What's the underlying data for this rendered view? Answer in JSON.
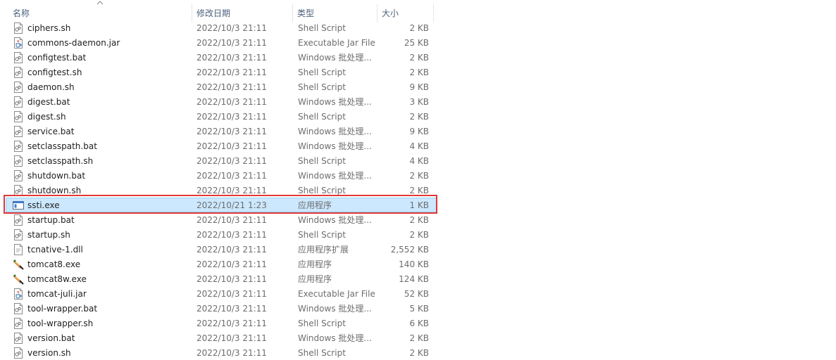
{
  "header": {
    "name": "名称",
    "date": "修改日期",
    "type": "类型",
    "size": "大小"
  },
  "colors": {
    "selected_bg": "#cce8ff",
    "selected_border": "#99d1ff",
    "highlight_box": "#e0383b",
    "header_text": "#4c607a"
  },
  "files": [
    {
      "name": "ciphers.sh",
      "date": "2022/10/3 21:11",
      "type": "Shell Script",
      "size": "2 KB",
      "icon": "script-file-icon"
    },
    {
      "name": "commons-daemon.jar",
      "date": "2022/10/3 21:11",
      "type": "Executable Jar File",
      "size": "25 KB",
      "icon": "jar-file-icon"
    },
    {
      "name": "configtest.bat",
      "date": "2022/10/3 21:11",
      "type": "Windows 批处理...",
      "size": "2 KB",
      "icon": "script-file-icon"
    },
    {
      "name": "configtest.sh",
      "date": "2022/10/3 21:11",
      "type": "Shell Script",
      "size": "2 KB",
      "icon": "script-file-icon"
    },
    {
      "name": "daemon.sh",
      "date": "2022/10/3 21:11",
      "type": "Shell Script",
      "size": "9 KB",
      "icon": "script-file-icon"
    },
    {
      "name": "digest.bat",
      "date": "2022/10/3 21:11",
      "type": "Windows 批处理...",
      "size": "3 KB",
      "icon": "script-file-icon"
    },
    {
      "name": "digest.sh",
      "date": "2022/10/3 21:11",
      "type": "Shell Script",
      "size": "2 KB",
      "icon": "script-file-icon"
    },
    {
      "name": "service.bat",
      "date": "2022/10/3 21:11",
      "type": "Windows 批处理...",
      "size": "9 KB",
      "icon": "script-file-icon"
    },
    {
      "name": "setclasspath.bat",
      "date": "2022/10/3 21:11",
      "type": "Windows 批处理...",
      "size": "4 KB",
      "icon": "script-file-icon"
    },
    {
      "name": "setclasspath.sh",
      "date": "2022/10/3 21:11",
      "type": "Shell Script",
      "size": "4 KB",
      "icon": "script-file-icon"
    },
    {
      "name": "shutdown.bat",
      "date": "2022/10/3 21:11",
      "type": "Windows 批处理...",
      "size": "2 KB",
      "icon": "script-file-icon"
    },
    {
      "name": "shutdown.sh",
      "date": "2022/10/3 21:11",
      "type": "Shell Script",
      "size": "2 KB",
      "icon": "script-file-icon"
    },
    {
      "name": "ssti.exe",
      "date": "2022/10/21 1:23",
      "type": "应用程序",
      "size": "1 KB",
      "icon": "exe-file-icon",
      "selected": true
    },
    {
      "name": "startup.bat",
      "date": "2022/10/3 21:11",
      "type": "Windows 批处理...",
      "size": "2 KB",
      "icon": "script-file-icon"
    },
    {
      "name": "startup.sh",
      "date": "2022/10/3 21:11",
      "type": "Shell Script",
      "size": "2 KB",
      "icon": "script-file-icon"
    },
    {
      "name": "tcnative-1.dll",
      "date": "2022/10/3 21:11",
      "type": "应用程序扩展",
      "size": "2,552 KB",
      "icon": "dll-file-icon"
    },
    {
      "name": "tomcat8.exe",
      "date": "2022/10/3 21:11",
      "type": "应用程序",
      "size": "140 KB",
      "icon": "tomcat-icon"
    },
    {
      "name": "tomcat8w.exe",
      "date": "2022/10/3 21:11",
      "type": "应用程序",
      "size": "124 KB",
      "icon": "tomcat-icon"
    },
    {
      "name": "tomcat-juli.jar",
      "date": "2022/10/3 21:11",
      "type": "Executable Jar File",
      "size": "52 KB",
      "icon": "jar-file-icon"
    },
    {
      "name": "tool-wrapper.bat",
      "date": "2022/10/3 21:11",
      "type": "Windows 批处理...",
      "size": "5 KB",
      "icon": "script-file-icon"
    },
    {
      "name": "tool-wrapper.sh",
      "date": "2022/10/3 21:11",
      "type": "Shell Script",
      "size": "6 KB",
      "icon": "script-file-icon"
    },
    {
      "name": "version.bat",
      "date": "2022/10/3 21:11",
      "type": "Windows 批处理...",
      "size": "2 KB",
      "icon": "script-file-icon"
    },
    {
      "name": "version.sh",
      "date": "2022/10/3 21:11",
      "type": "Shell Script",
      "size": "2 KB",
      "icon": "script-file-icon"
    }
  ]
}
